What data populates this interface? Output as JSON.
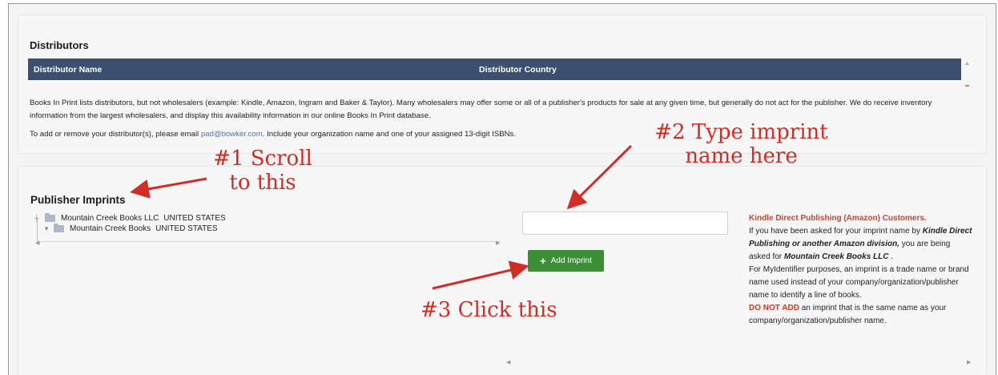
{
  "distributors": {
    "title": "Distributors",
    "columns": [
      "Distributor Name",
      "Distributor Country"
    ],
    "paragraph1": "Books In Print lists distributors, but not wholesalers (example: Kindle, Amazon, Ingram and Baker & Taylor). Many wholesalers may offer some or all of a publisher's products for sale at any given time, but generally do not act for the publisher. We do receive inventory information from the largest wholesalers, and display this availability information in our online Books In Print database.",
    "paragraph2_before": "To add or remove your distributor(s), please email ",
    "email": "pad@bowker.com",
    "paragraph2_after": ". Include your organization name and one of your assigned 13-digit ISBNs."
  },
  "imprints": {
    "title": "Publisher Imprints",
    "tree": [
      {
        "name": "Mountain Creek Books LLC",
        "country": "UNITED STATES"
      },
      {
        "name": "Mountain Creek Books",
        "country": "UNITED STATES"
      }
    ],
    "input_value": "",
    "add_button_label": "Add Imprint"
  },
  "sidebar": {
    "heading": "Kindle Direct Publishing (Amazon) Customers.",
    "line1_pre": "If you have been asked for your imprint name by ",
    "line1_em": "Kindle Direct Publishing or another Amazon division,",
    "line1_mid": " you are being asked for ",
    "line1_em2": "Mountain Creek Books LLC",
    "line1_end": " .",
    "line2": "For MyIdentifier purposes, an imprint is a trade name or brand name used instead of your company/organization/publisher name to identify a line of books.",
    "warn": "DO NOT ADD",
    "line3": " an imprint that is the same name as your company/organization/publisher name."
  },
  "annotations": {
    "step1_line1": "#1 Scroll",
    "step1_line2": "to this",
    "step2_line1": "#2 Type imprint",
    "step2_line2": "name here",
    "step3": "#3 Click this"
  },
  "colors": {
    "table_header": "#3d4f6e",
    "add_button": "#3e8e38",
    "annotation": "#cf2d26",
    "link": "#4a72b8"
  }
}
